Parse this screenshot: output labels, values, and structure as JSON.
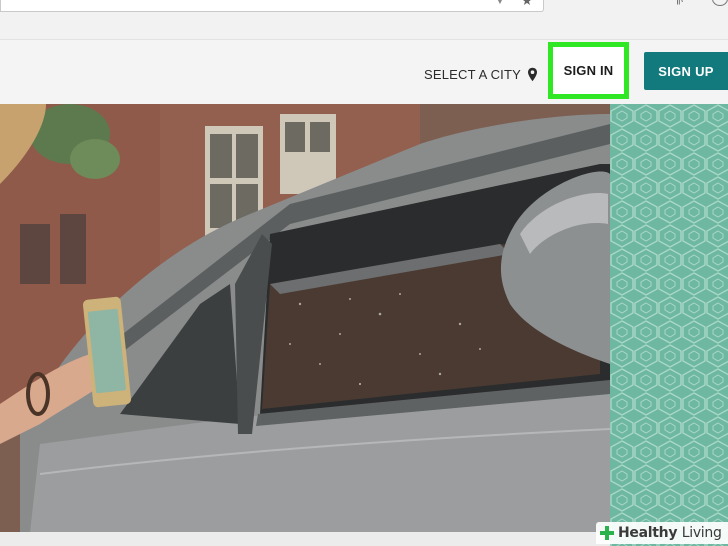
{
  "header": {
    "select_city_label": "SELECT A CITY",
    "sign_in_label": "SIGN IN",
    "sign_up_label": "SIGN UP"
  },
  "icons": {
    "city": "map-pin-icon",
    "bookmark": "star-icon",
    "library": "library-icon"
  },
  "watermark": {
    "brand_bold": "Healthy",
    "brand_light": "Living"
  },
  "colors": {
    "highlight": "#2fe823",
    "sign_up_bg": "#12797d",
    "pattern_bg": "#6eb8a2",
    "pattern_line": "#a8d8c6",
    "watermark_cross": "#2bb24c"
  }
}
